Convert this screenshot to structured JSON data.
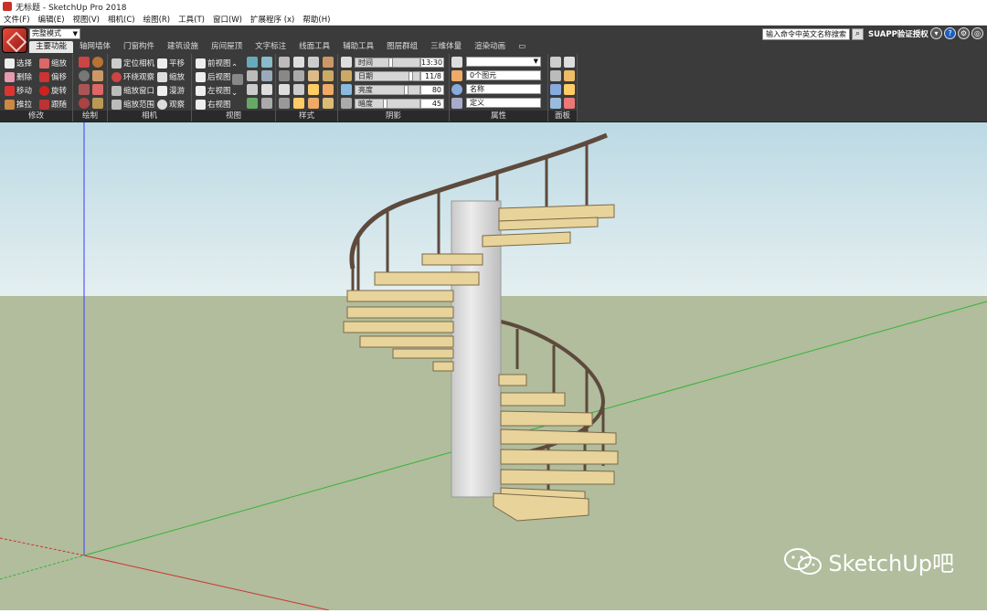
{
  "window": {
    "title": "无标题 - SketchUp Pro 2018"
  },
  "menu": [
    "文件(F)",
    "编辑(E)",
    "视图(V)",
    "相机(C)",
    "绘图(R)",
    "工具(T)",
    "窗口(W)",
    "扩展程序 (x)",
    "帮助(H)"
  ],
  "ribbon": {
    "style_select": "完整模式",
    "search_placeholder": "输入命令中英文名称搜索",
    "suapp_label": "SUAPP验证授权",
    "tabs": [
      "主要功能",
      "轴网墙体",
      "门窗构件",
      "建筑设施",
      "房间屋顶",
      "文字标注",
      "线面工具",
      "辅助工具",
      "图层群组",
      "三维体量",
      "渲染动画"
    ],
    "groups": {
      "modify": {
        "title": "修改",
        "tools": [
          "选择",
          "缩放",
          "删除",
          "偏移",
          "移动",
          "旋转",
          "推拉",
          "跟随"
        ]
      },
      "draw": {
        "title": "绘制"
      },
      "camera": {
        "title": "相机",
        "tools": [
          "定位相机",
          "平移",
          "环绕观察",
          "缩放",
          "缩放窗口",
          "漫游",
          "缩放范围",
          "观察"
        ]
      },
      "views": {
        "title": "视图",
        "tools": [
          "前视图",
          "后视图",
          "左视图",
          "右视图"
        ]
      },
      "styles": {
        "title": "样式"
      },
      "shadows": {
        "title": "阴影",
        "rows": [
          {
            "label": "时间",
            "value": "13:30",
            "level": 0.55
          },
          {
            "label": "日期",
            "value": "11/8",
            "level": 0.88
          },
          {
            "label": "亮度",
            "value": "80",
            "level": 0.8
          },
          {
            "label": "暗度",
            "value": "45",
            "level": 0.45
          }
        ]
      },
      "properties": {
        "title": "属性",
        "fields": [
          "",
          "0个图元",
          "名称",
          "定义"
        ]
      },
      "panels": {
        "title": "面板"
      }
    }
  },
  "watermark": "SketchUp吧",
  "colors": {
    "sky": "#cfe3ea",
    "ground": "#b1bd9d",
    "wood": "#e8d39a",
    "rail": "#5d4a3c",
    "column": "#d9d9d9"
  }
}
